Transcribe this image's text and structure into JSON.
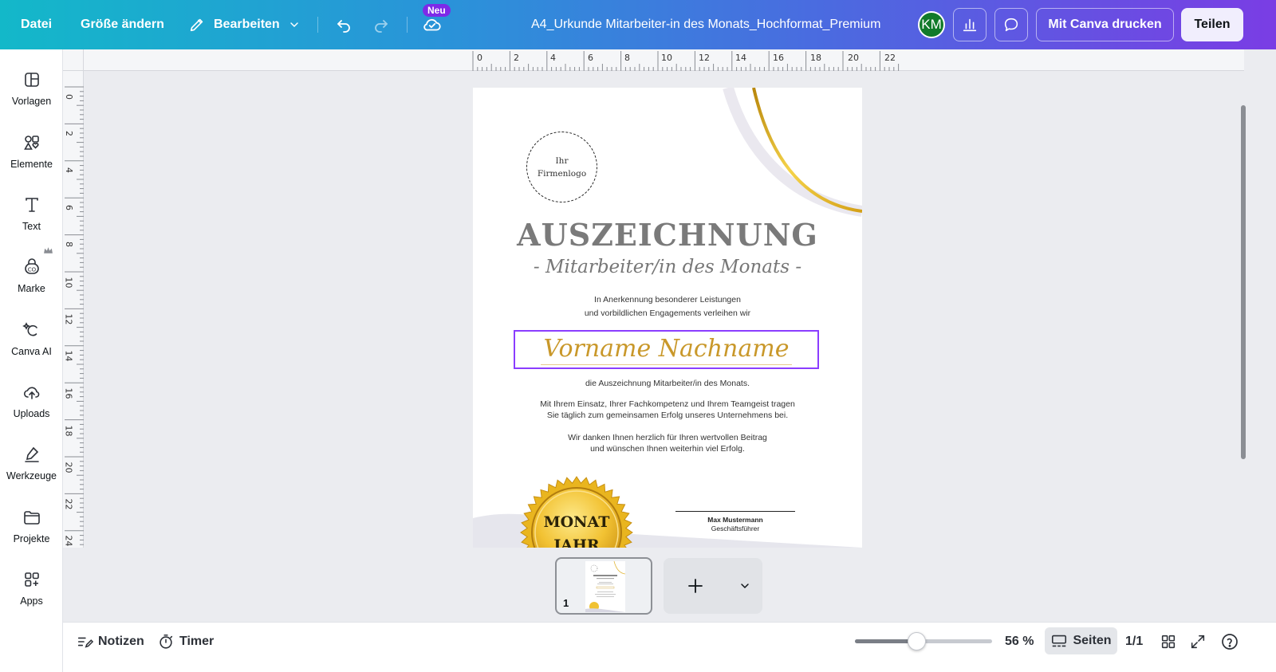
{
  "topbar": {
    "file_label": "Datei",
    "resize_label": "Größe ändern",
    "edit_label": "Bearbeiten",
    "new_badge": "Neu",
    "doc_title": "A4_Urkunde Mitarbeiter-in des Monats_Hochformat_Premium",
    "avatar_initials": "KM",
    "print_label": "Mit Canva drucken",
    "share_label": "Teilen"
  },
  "sidebar": {
    "items": [
      {
        "label": "Vorlagen",
        "icon": "templates-icon"
      },
      {
        "label": "Elemente",
        "icon": "elements-icon"
      },
      {
        "label": "Text",
        "icon": "text-icon"
      },
      {
        "label": "Marke",
        "icon": "brand-icon"
      },
      {
        "label": "Canva AI",
        "icon": "canva-ai-icon"
      },
      {
        "label": "Uploads",
        "icon": "uploads-icon"
      },
      {
        "label": "Werkzeuge",
        "icon": "tools-icon"
      },
      {
        "label": "Projekte",
        "icon": "projects-icon"
      },
      {
        "label": "Apps",
        "icon": "apps-icon"
      }
    ]
  },
  "ruler": {
    "h": [
      "0",
      "2",
      "4",
      "6",
      "8",
      "10",
      "12",
      "14",
      "16",
      "18",
      "20",
      "22"
    ],
    "v": [
      "0",
      "2",
      "4",
      "6",
      "8",
      "10",
      "12",
      "14",
      "16",
      "18",
      "20",
      "22",
      "24"
    ]
  },
  "certificate": {
    "logo_line1": "Ihr",
    "logo_line2": "Firmenlogo",
    "title": "AUSZEICHNUNG",
    "subtitle": "- Mitarbeiter/in des Monats -",
    "intro_line1": "In Anerkennung besonderer Leistungen",
    "intro_line2": "und vorbildlichen Engagements verleihen wir",
    "name": "Vorname Nachname",
    "award_line": "die Auszeichnung Mitarbeiter/in des Monats.",
    "para1_line1": "Mit Ihrem Einsatz, Ihrer Fachkompetenz und Ihrem Teamgeist tragen",
    "para1_line2": "Sie täglich zum gemeinsamen Erfolg unseres Unternehmens bei.",
    "para2_line1": "Wir danken Ihnen herzlich für Ihren wertvollen Beitrag",
    "para2_line2": "und wünschen Ihnen weiterhin viel Erfolg.",
    "seal_line1": "MONAT",
    "seal_line2": "JAHR",
    "signer_name": "Max Mustermann",
    "signer_role": "Geschäftsführer"
  },
  "pages": {
    "thumb_number": "1"
  },
  "bottombar": {
    "notes_label": "Notizen",
    "timer_label": "Timer",
    "zoom_value": "56 %",
    "pages_label": "Seiten",
    "page_count": "1/1",
    "zoom_fraction": 0.45
  },
  "colors": {
    "accent": "#8b3dff",
    "gold": "#c9982a"
  }
}
